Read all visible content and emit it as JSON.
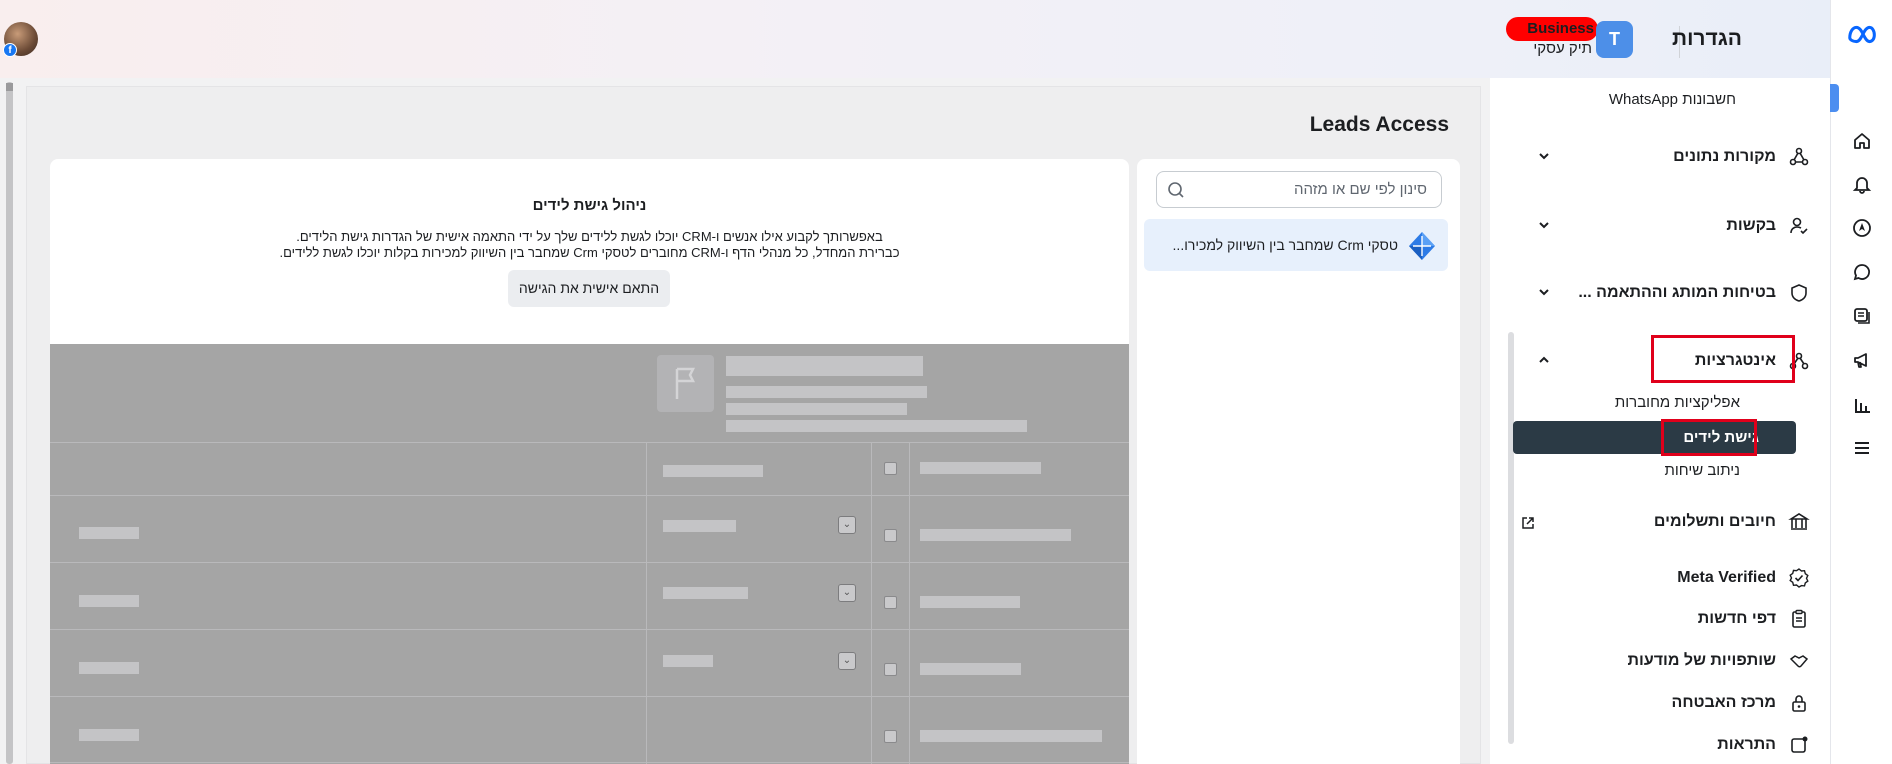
{
  "header": {
    "title": "הגדרות",
    "business_initial": "T",
    "business_name": "Business",
    "business_type": "תיק עסקי"
  },
  "sidebar": {
    "whatsapp": "חשבונות WhatsApp",
    "items": [
      {
        "label": "מקורות נתונים",
        "icon": "data-sources-icon"
      },
      {
        "label": "בקשות",
        "icon": "user-check-icon"
      },
      {
        "label": "בטיחות המותג וההתאמה ...",
        "icon": "shield-icon"
      },
      {
        "label": "אינטגרציות",
        "icon": "integrations-icon"
      },
      {
        "label": "חיובים ותשלומים",
        "icon": "bank-icon"
      },
      {
        "label": "Meta Verified",
        "icon": "verified-icon"
      },
      {
        "label": "דפי חדשות",
        "icon": "clipboard-icon"
      },
      {
        "label": "שותפויות של מודעות",
        "icon": "handshake-icon"
      },
      {
        "label": "מרכז האבטחה",
        "icon": "lock-icon"
      },
      {
        "label": "התראות",
        "icon": "notification-icon"
      }
    ],
    "sub_items": {
      "connected_apps": "אפליקציות מחוברות",
      "leads_access": "גישת לידים",
      "conversation_routing": "ניתוב שיחות"
    }
  },
  "main": {
    "title": "Leads Access",
    "search_placeholder": "סינון לפי שם או מזהה",
    "list_items": [
      "טסקי Crm שמחבר בין השיווק למכירו..."
    ],
    "card": {
      "title": "ניהול גישת לידים",
      "desc_line1": "באפשרותך לקבוע אילו אנשים ו-CRM יוכלו לגשת ללידים שלך על ידי התאמה אישית של הגדרות גישת הלידים.",
      "desc_line2": "כברירת המחדל, כל מנהלי הדף ו-CRM מחוברים לטסקי Crm שמחבר בין השיווק למכירות בקלות יוכלו לגשת ללידים.",
      "button": "התאם אישית את הגישה"
    }
  },
  "colors": {
    "accent": "#1877f2",
    "active_nav": "#2b3a45",
    "highlight": "#e0001b"
  }
}
